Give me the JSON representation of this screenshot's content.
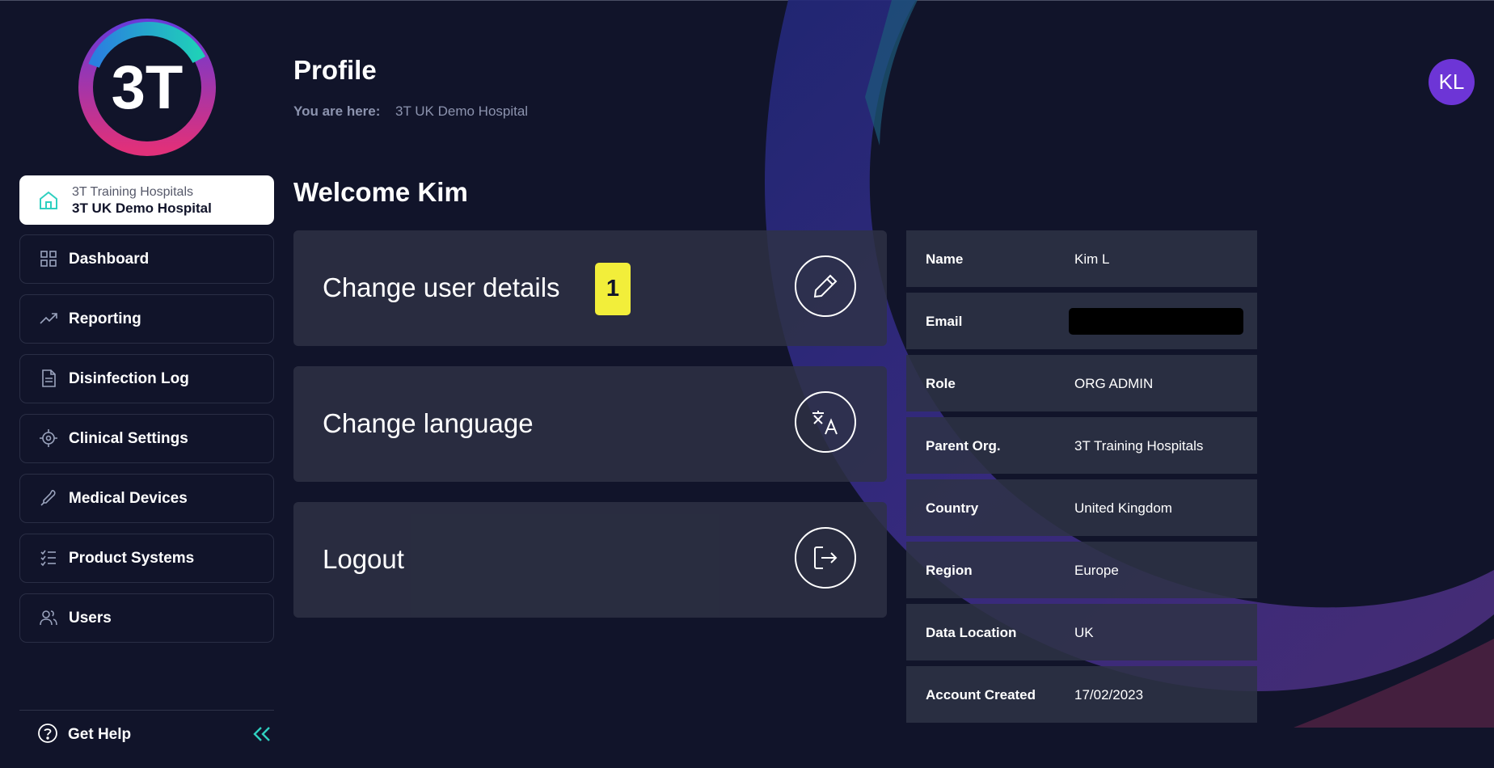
{
  "org_card": {
    "parent": "3T Training Hospitals",
    "current": "3T UK Demo Hospital"
  },
  "logo": {
    "text": "3T"
  },
  "nav": {
    "items": [
      {
        "label": "Dashboard",
        "icon": "grid-icon"
      },
      {
        "label": "Reporting",
        "icon": "trend-up-icon"
      },
      {
        "label": "Disinfection Log",
        "icon": "document-icon"
      },
      {
        "label": "Clinical Settings",
        "icon": "target-gear-icon"
      },
      {
        "label": "Medical Devices",
        "icon": "probe-icon"
      },
      {
        "label": "Product Systems",
        "icon": "checklist-icon"
      },
      {
        "label": "Users",
        "icon": "users-icon"
      }
    ]
  },
  "help": {
    "label": "Get Help"
  },
  "header": {
    "title": "Profile",
    "crumb_label": "You are here:",
    "crumb_value": "3T UK Demo Hospital"
  },
  "avatar": {
    "initials": "KL"
  },
  "welcome": "Welcome Kim",
  "actions": [
    {
      "label": "Change user details",
      "badge": "1",
      "icon": "pencil-icon"
    },
    {
      "label": "Change language",
      "icon": "translate-icon"
    },
    {
      "label": "Logout",
      "icon": "logout-icon"
    }
  ],
  "details": [
    {
      "label": "Name",
      "value": "Kim L"
    },
    {
      "label": "Email",
      "value": ""
    },
    {
      "label": "Role",
      "value": "ORG ADMIN"
    },
    {
      "label": "Parent Org.",
      "value": "3T Training Hospitals"
    },
    {
      "label": "Country",
      "value": "United Kingdom"
    },
    {
      "label": "Region",
      "value": "Europe"
    },
    {
      "label": "Data Location",
      "value": "UK"
    },
    {
      "label": "Account Created",
      "value": "17/02/2023"
    }
  ],
  "colors": {
    "background": "#11142a",
    "card": "#2e3245",
    "accent_teal": "#2fd0c0",
    "avatar": "#6d35d6",
    "badge": "#f2ee3a"
  }
}
